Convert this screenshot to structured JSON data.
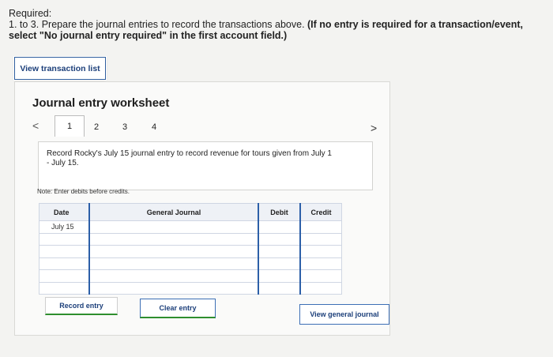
{
  "required": {
    "label": "Required:",
    "prefix": "1. to 3.",
    "text": " Prepare the journal entries to record the transactions above. ",
    "bold_note": "(If no entry is required for a transaction/event, select \"No journal entry required\" in the first account field.)"
  },
  "view_transaction_list": "View transaction list",
  "worksheet": {
    "title": "Journal entry worksheet",
    "pager": {
      "prev": "<",
      "next": ">",
      "tabs": [
        "1",
        "2",
        "3",
        "4"
      ]
    },
    "instruction": "Record Rocky's July 15 journal entry to record revenue for tours given from July 1 - July 15.",
    "note": "Note: Enter debits before credits.",
    "table": {
      "headers": {
        "date": "Date",
        "account": "General Journal",
        "debit": "Debit",
        "credit": "Credit"
      },
      "rows": [
        {
          "date": "July 15"
        },
        {
          "date": ""
        },
        {
          "date": ""
        },
        {
          "date": ""
        },
        {
          "date": ""
        },
        {
          "date": ""
        }
      ]
    },
    "buttons": {
      "record": "Record entry",
      "clear": "Clear entry",
      "view_journal": "View general journal"
    }
  }
}
